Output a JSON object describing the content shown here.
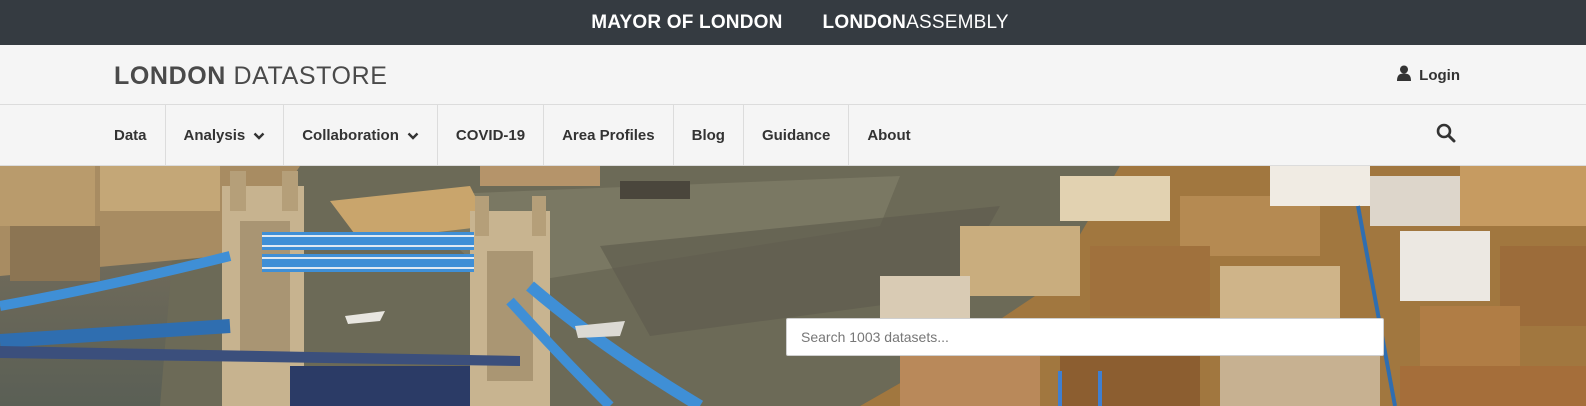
{
  "topbar": {
    "mayor_label": "MAYOR OF LONDON",
    "assembly_bold": "LONDON",
    "assembly_light": "ASSEMBLY"
  },
  "header": {
    "logo_bold": "LONDON",
    "logo_light": " DATASTORE",
    "login_label": "Login",
    "login_icon": "user-icon"
  },
  "nav": {
    "items": [
      {
        "label": "Data",
        "has_dropdown": false
      },
      {
        "label": "Analysis",
        "has_dropdown": true
      },
      {
        "label": "Collaboration",
        "has_dropdown": true
      },
      {
        "label": "COVID-19",
        "has_dropdown": false
      },
      {
        "label": "Area Profiles",
        "has_dropdown": false
      },
      {
        "label": "Blog",
        "has_dropdown": false
      },
      {
        "label": "Guidance",
        "has_dropdown": false
      },
      {
        "label": "About",
        "has_dropdown": false
      }
    ],
    "search_icon": "search-icon"
  },
  "hero": {
    "search_placeholder": "Search 1003 datasets..."
  },
  "colors": {
    "topbar_bg": "#353b41",
    "header_bg": "#f5f5f5",
    "text": "#333333",
    "bridge_blue": "#3f8fd6"
  }
}
